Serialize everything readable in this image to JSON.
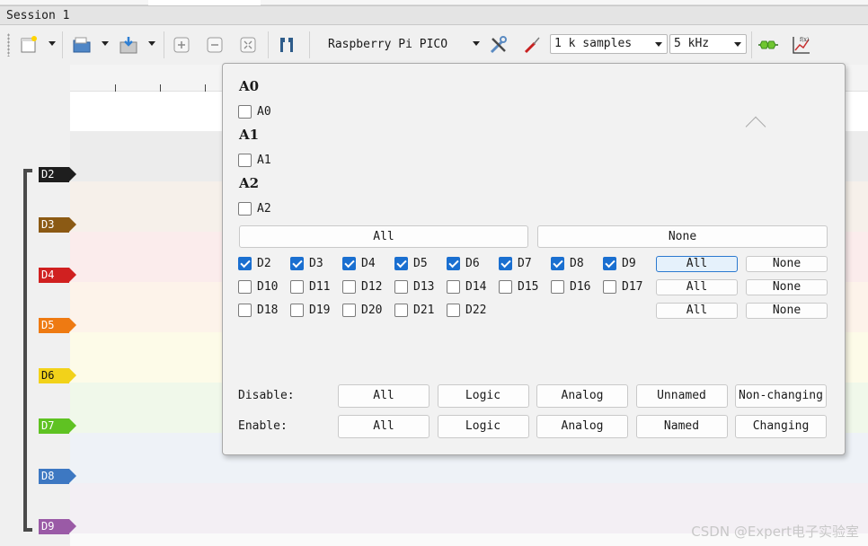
{
  "session": {
    "tab_label": "Session 1"
  },
  "toolbar": {
    "device": "Raspberry Pi PICO",
    "samples": "1 k samples",
    "rate": "5 kHz",
    "icons": [
      "new-session-icon",
      "open-folder-icon",
      "save-icon",
      "zoom-in-icon",
      "zoom-out-icon",
      "zoom-fit-icon",
      "cursor-icon",
      "tools-icon",
      "probe-icon",
      "decoder-icon",
      "math-icon"
    ]
  },
  "channels": [
    {
      "label": "D2",
      "color": "#1e1e1e",
      "band": "#ececec"
    },
    {
      "label": "D3",
      "color": "#8b5a14",
      "band": "#f6f0ea"
    },
    {
      "label": "D4",
      "color": "#d02020",
      "band": "#fbecec"
    },
    {
      "label": "D5",
      "color": "#ee7a12",
      "band": "#fdf3ea"
    },
    {
      "label": "D6",
      "color": "#f2d21a",
      "band": "#fdfbe8"
    },
    {
      "label": "D7",
      "color": "#5fc222",
      "band": "#f0f8ea"
    },
    {
      "label": "D8",
      "color": "#3d78c2",
      "band": "#eef2f7"
    },
    {
      "label": "D9",
      "color": "#9a5aa6",
      "band": "#f3eff4"
    }
  ],
  "popup": {
    "analog_groups": [
      {
        "title": "A0",
        "channel": "A0",
        "checked": false
      },
      {
        "title": "A1",
        "channel": "A1",
        "checked": false
      },
      {
        "title": "A2",
        "channel": "A2",
        "checked": false
      }
    ],
    "analog_all": "All",
    "analog_none": "None",
    "logic_rows": [
      {
        "channels": [
          {
            "label": "D2",
            "checked": true
          },
          {
            "label": "D3",
            "checked": true
          },
          {
            "label": "D4",
            "checked": true
          },
          {
            "label": "D5",
            "checked": true
          },
          {
            "label": "D6",
            "checked": true
          },
          {
            "label": "D7",
            "checked": true
          },
          {
            "label": "D8",
            "checked": true
          },
          {
            "label": "D9",
            "checked": true
          }
        ],
        "all": "All",
        "none": "None"
      },
      {
        "channels": [
          {
            "label": "D10",
            "checked": false
          },
          {
            "label": "D11",
            "checked": false
          },
          {
            "label": "D12",
            "checked": false
          },
          {
            "label": "D13",
            "checked": false
          },
          {
            "label": "D14",
            "checked": false
          },
          {
            "label": "D15",
            "checked": false
          },
          {
            "label": "D16",
            "checked": false
          },
          {
            "label": "D17",
            "checked": false
          }
        ],
        "all": "All",
        "none": "None"
      },
      {
        "channels": [
          {
            "label": "D18",
            "checked": false
          },
          {
            "label": "D19",
            "checked": false
          },
          {
            "label": "D20",
            "checked": false
          },
          {
            "label": "D21",
            "checked": false
          },
          {
            "label": "D22",
            "checked": false
          }
        ],
        "all": "All",
        "none": "None"
      }
    ],
    "disable": {
      "label": "Disable:",
      "buttons": [
        "All",
        "Logic",
        "Analog",
        "Unnamed",
        "Non-changing"
      ]
    },
    "enable": {
      "label": "Enable:",
      "buttons": [
        "All",
        "Logic",
        "Analog",
        "Named",
        "Changing"
      ]
    }
  },
  "watermark": "CSDN @Expert电子实验室"
}
